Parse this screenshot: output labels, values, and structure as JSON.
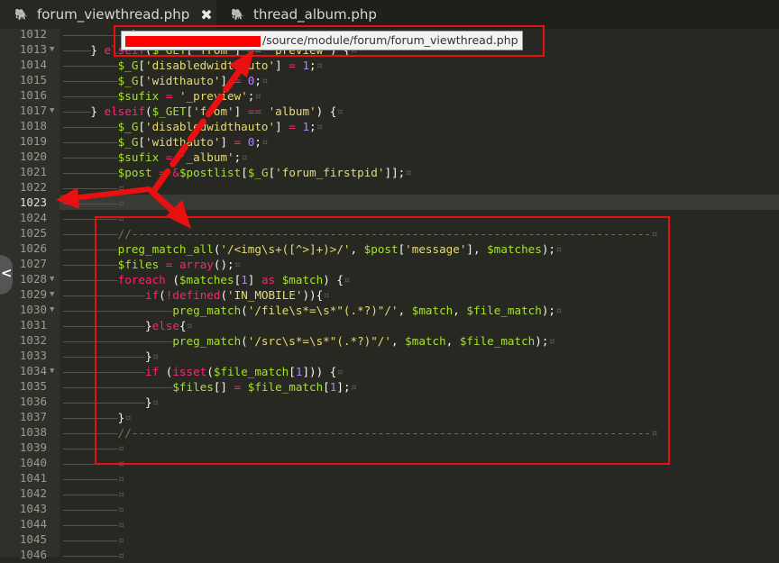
{
  "tabs": [
    {
      "label": "forum_viewthread.php",
      "active": true,
      "close": "✖"
    },
    {
      "label": "thread_album.php",
      "active": false
    }
  ],
  "tooltip_path": "/source/module/forum/forum_viewthread.php",
  "line_numbers": [
    "1012",
    "1013",
    "1014",
    "1015",
    "1016",
    "1017",
    "1018",
    "1019",
    "1020",
    "1021",
    "1022",
    "1023",
    "1024",
    "1025",
    "1026",
    "1027",
    "1028",
    "1029",
    "1030",
    "1031",
    "1032",
    "1033",
    "1034",
    "1035",
    "1036",
    "1037",
    "1038",
    "1039",
    "1040",
    "1041",
    "1042",
    "1043",
    "1044",
    "1045",
    "1046"
  ],
  "current_line": "1023",
  "colors": {
    "keyword": "#f92672",
    "variable": "#a6e22e",
    "string": "#e6db74",
    "number": "#ae81ff",
    "annotation": "#e81010"
  }
}
